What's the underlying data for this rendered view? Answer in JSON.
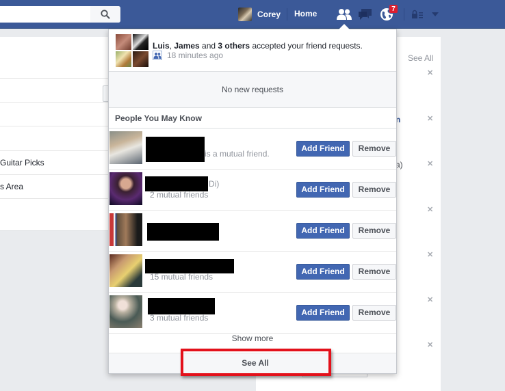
{
  "topbar": {
    "search_placeholder": "",
    "user_name": "Corey",
    "home_label": "Home",
    "notifications_badge": "7",
    "icons": [
      "search-icon",
      "friend-requests-icon",
      "messages-icon",
      "notifications-globe-icon",
      "privacy-lock-icon",
      "account-dropdown-icon"
    ]
  },
  "background_page": {
    "left_items": [
      "Guitar Picks",
      "s Area"
    ],
    "right_see_all": "See All",
    "right_fragments": [
      "n",
      "a)"
    ]
  },
  "dropdown": {
    "accepted": {
      "name1": "Luis",
      "sep1": ", ",
      "name2": "James",
      "sep2": " and ",
      "others": "3 others",
      "suffix": " accepted your friend requests.",
      "time": "18 minutes ago"
    },
    "no_requests": "No new requests",
    "pymk_title": "People You May Know",
    "people": [
      {
        "name": "[redacted]",
        "subtitle": "is a mutual friend.",
        "add_label": "Add Friend",
        "remove_label": "Remove"
      },
      {
        "name": "[redacted]",
        "name_suffix": "Di)",
        "subtitle": "2 mutual friends",
        "add_label": "Add Friend",
        "remove_label": "Remove"
      },
      {
        "name": "[redacted]",
        "subtitle": "",
        "add_label": "Add Friend",
        "remove_label": "Remove"
      },
      {
        "name": "[redacted]",
        "subtitle": "15 mutual friends",
        "add_label": "Add Friend",
        "remove_label": "Remove"
      },
      {
        "name": "[redacted]",
        "subtitle": "3 mutual friends",
        "add_label": "Add Friend",
        "remove_label": "Remove"
      }
    ],
    "show_more": "Show more",
    "see_all": "See All"
  },
  "colors": {
    "brand_blue": "#3b5998",
    "add_button": "#4267b2",
    "badge_red": "#dd1e2f",
    "highlight_red": "#e3111b"
  }
}
